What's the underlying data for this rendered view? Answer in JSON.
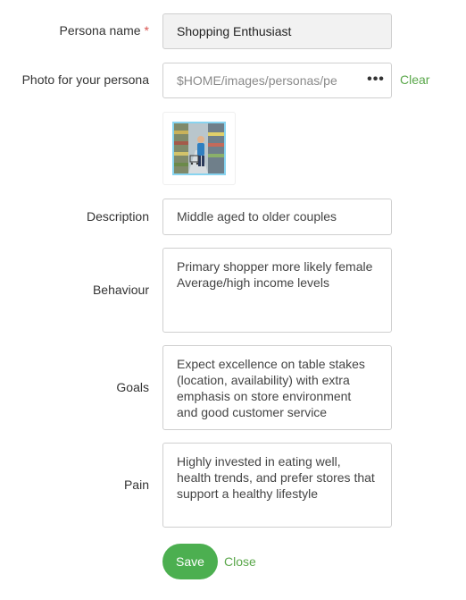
{
  "persona_name": {
    "label": "Persona name",
    "required_marker": "*",
    "value": "Shopping Enthusiast"
  },
  "photo": {
    "label": "Photo for your persona",
    "value": "$HOME/images/personas/pe",
    "browse_glyph": "•••",
    "clear_label": "Clear",
    "thumbnail_icon": "shopper-photo"
  },
  "description": {
    "label": "Description",
    "value": "Middle aged to older couples"
  },
  "behaviour": {
    "label": "Behaviour",
    "value": "Primary shopper more likely female\nAverage/high income levels"
  },
  "goals": {
    "label": "Goals",
    "value": "Expect excellence on table stakes\n(location, availability) with extra\nemphasis on store environment\nand good customer service"
  },
  "pain": {
    "label": "Pain",
    "value": "Highly invested in eating well,\nhealth trends, and prefer stores that\nsupport a healthy lifestyle"
  },
  "actions": {
    "save_label": "Save",
    "close_label": "Close"
  },
  "colors": {
    "accent": "#5aa74a",
    "save_button": "#4caf50",
    "required": "#d9534f",
    "thumbnail_border": "#87d4f0"
  }
}
